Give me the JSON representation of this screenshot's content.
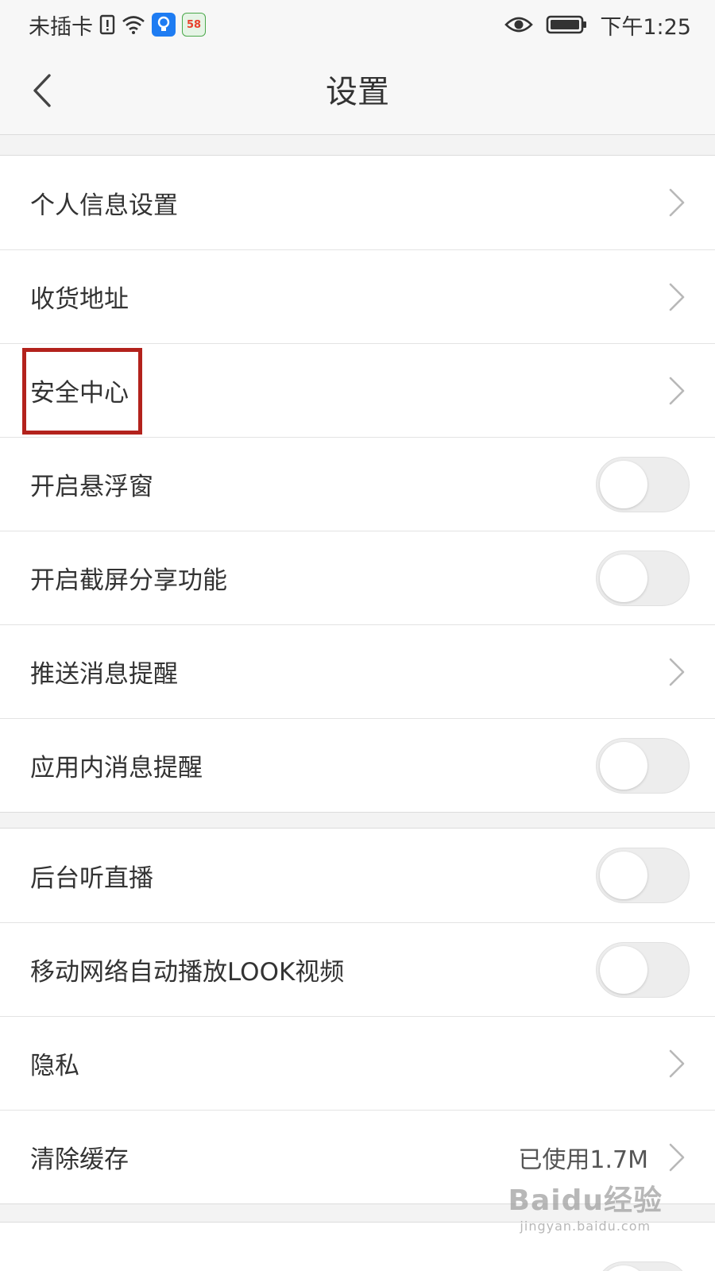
{
  "status_bar": {
    "carrier": "未插卡",
    "time": "下午1:25",
    "app_badge_58": "58",
    "icons": [
      "sim-alert-icon",
      "wifi-icon",
      "bulb-app-icon",
      "app-58-icon",
      "eye-icon",
      "battery-icon"
    ]
  },
  "nav": {
    "title": "设置",
    "back_icon": "chevron-left-icon"
  },
  "groups": [
    {
      "items": [
        {
          "label": "个人信息设置",
          "control": "chevron"
        },
        {
          "label": "收货地址",
          "control": "chevron"
        },
        {
          "label": "安全中心",
          "control": "chevron",
          "highlighted": true
        },
        {
          "label": "开启悬浮窗",
          "control": "toggle",
          "on": false
        },
        {
          "label": "开启截屏分享功能",
          "control": "toggle",
          "on": false
        },
        {
          "label": "推送消息提醒",
          "control": "chevron"
        },
        {
          "label": "应用内消息提醒",
          "control": "toggle",
          "on": false
        }
      ]
    },
    {
      "items": [
        {
          "label": "后台听直播",
          "control": "toggle",
          "on": false
        },
        {
          "label": "移动网络自动播放LOOK视频",
          "control": "toggle",
          "on": false
        },
        {
          "label": "隐私",
          "control": "chevron"
        },
        {
          "label": "清除缓存",
          "control": "chevron",
          "value": "已使用1.7M"
        }
      ]
    }
  ],
  "watermark": {
    "main": "Baidu经验",
    "sub": "jingyan.baidu.com"
  },
  "colors": {
    "highlight": "#b3221c",
    "background": "#f3f3f3",
    "toggle_off": "#ededed"
  }
}
